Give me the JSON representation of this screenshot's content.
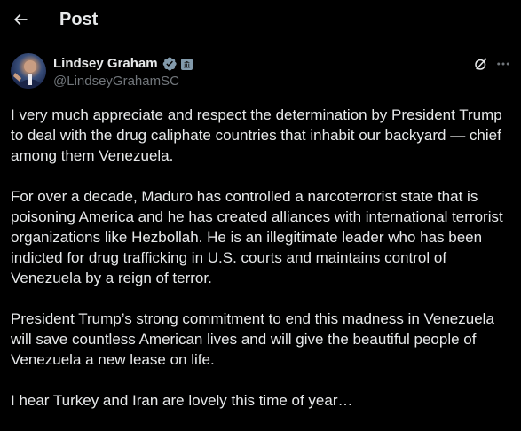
{
  "header": {
    "title": "Post",
    "back_icon": "arrow-left-icon"
  },
  "author": {
    "display_name": "Lindsey Graham",
    "handle": "@LindseyGrahamSC",
    "verified_icon": "verified-badge-icon",
    "affiliation_icon": "government-badge-icon"
  },
  "actions": {
    "grok_icon": "grok-icon",
    "more_icon": "more-horizontal-icon"
  },
  "post": {
    "paragraphs": [
      "I very much appreciate and respect the determination by President Trump to deal with the drug caliphate countries that inhabit our backyard — chief among them Venezuela.",
      "For over a decade, Maduro has controlled a narcoterrorist state that is poisoning America and he has created alliances with international terrorist organizations like Hezbollah. He is an illegitimate leader who has been indicted for drug trafficking in U.S. courts and maintains control of Venezuela by a reign of terror.",
      "President Trump’s strong commitment to end this madness in Venezuela will save countless American lives and will give the beautiful people of Venezuela a new lease on life.",
      "I hear Turkey and Iran are lovely this time of year…"
    ]
  },
  "colors": {
    "background": "#000000",
    "text_primary": "#e7e9ea",
    "text_secondary": "#71767b",
    "verified": "#829aab"
  }
}
